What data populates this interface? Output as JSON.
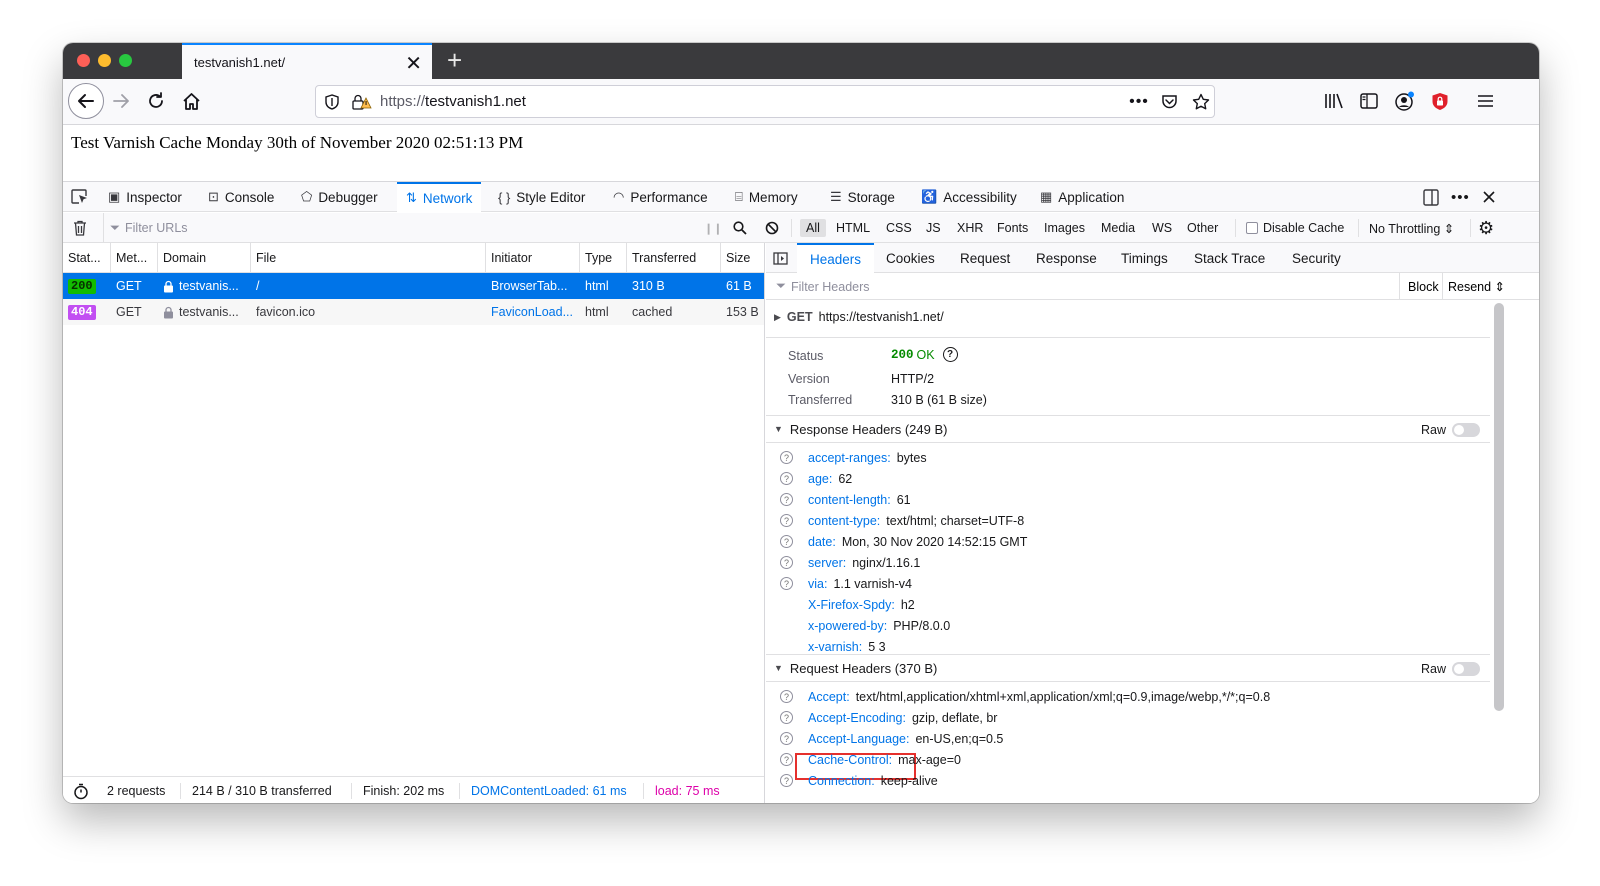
{
  "browser": {
    "tab_title": "testvanish1.net/",
    "tab_close": "✕",
    "new_tab": "+",
    "url_protocol": "https://",
    "url_host": "testvanish1.net"
  },
  "page": {
    "text": "Test Varnish Cache Monday 30th of November 2020 02:51:13 PM"
  },
  "devtools": {
    "tabs": [
      {
        "label": "Inspector"
      },
      {
        "label": "Console"
      },
      {
        "label": "Debugger"
      },
      {
        "label": "Network"
      },
      {
        "label": "Style Editor"
      },
      {
        "label": "Performance"
      },
      {
        "label": "Memory"
      },
      {
        "label": "Storage"
      },
      {
        "label": "Accessibility"
      },
      {
        "label": "Application"
      }
    ],
    "network_toolbar": {
      "filter_placeholder": "Filter URLs",
      "pause": "❙❙",
      "filters": [
        "All",
        "HTML",
        "CSS",
        "JS",
        "XHR",
        "Fonts",
        "Images",
        "Media",
        "WS",
        "Other"
      ],
      "disable_cache": "Disable Cache",
      "throttling": "No Throttling ⇕"
    },
    "columns": [
      "Stat...",
      "Met...",
      "Domain",
      "File",
      "Initiator",
      "Type",
      "Transferred",
      "Size"
    ],
    "requests": [
      {
        "status": "200",
        "method": "GET",
        "domain": "testvanis...",
        "file": "/",
        "initiator": "BrowserTab...",
        "type": "html",
        "transferred": "310 B",
        "size": "61 B"
      },
      {
        "status": "404",
        "method": "GET",
        "domain": "testvanis...",
        "file": "favicon.ico",
        "initiator": "FaviconLoad...",
        "type": "html",
        "transferred": "cached",
        "size": "153 B"
      }
    ],
    "footer": {
      "requests": "2 requests",
      "transferred": "214 B / 310 B transferred",
      "finish": "Finish: 202 ms",
      "dom_loaded": "DOMContentLoaded: 61 ms",
      "load": "load: 75 ms"
    },
    "details": {
      "tabs": [
        "Headers",
        "Cookies",
        "Request",
        "Response",
        "Timings",
        "Stack Trace",
        "Security"
      ],
      "filter_placeholder": "Filter Headers",
      "block": "Block",
      "resend": "Resend ⇕",
      "summary_method": "GET",
      "summary_url": "https://testvanish1.net/",
      "status_label": "Status",
      "status_code": "200",
      "status_text": "OK",
      "help_mark": "?",
      "version_label": "Version",
      "version": "HTTP/2",
      "transferred_label": "Transferred",
      "transferred": "310 B (61 B size)",
      "response_headers_title": "Response Headers (249 B)",
      "request_headers_title": "Request Headers (370 B)",
      "raw_label": "Raw",
      "response_headers": [
        {
          "name": "accept-ranges:",
          "value": "bytes"
        },
        {
          "name": "age:",
          "value": "62"
        },
        {
          "name": "content-length:",
          "value": "61"
        },
        {
          "name": "content-type:",
          "value": "text/html; charset=UTF-8"
        },
        {
          "name": "date:",
          "value": "Mon, 30 Nov 2020 14:52:15 GMT"
        },
        {
          "name": "server:",
          "value": "nginx/1.16.1"
        },
        {
          "name": "via:",
          "value": "1.1 varnish-v4"
        },
        {
          "name": "X-Firefox-Spdy:",
          "value": "h2"
        },
        {
          "name": "x-powered-by:",
          "value": "PHP/8.0.0"
        },
        {
          "name": "x-varnish:",
          "value": "5 3"
        }
      ],
      "request_headers": [
        {
          "name": "Accept:",
          "value": "text/html,application/xhtml+xml,application/xml;q=0.9,image/webp,*/*;q=0.8"
        },
        {
          "name": "Accept-Encoding:",
          "value": "gzip, deflate, br"
        },
        {
          "name": "Accept-Language:",
          "value": "en-US,en;q=0.5"
        },
        {
          "name": "Cache-Control:",
          "value": "max-age=0"
        },
        {
          "name": "Connection:",
          "value": "keep-alive"
        }
      ]
    }
  },
  "colors": {
    "accent": "#0074e8",
    "status_ok": "#12bc00",
    "status_404": "#c24ff2",
    "highlight": "#e5302d"
  }
}
